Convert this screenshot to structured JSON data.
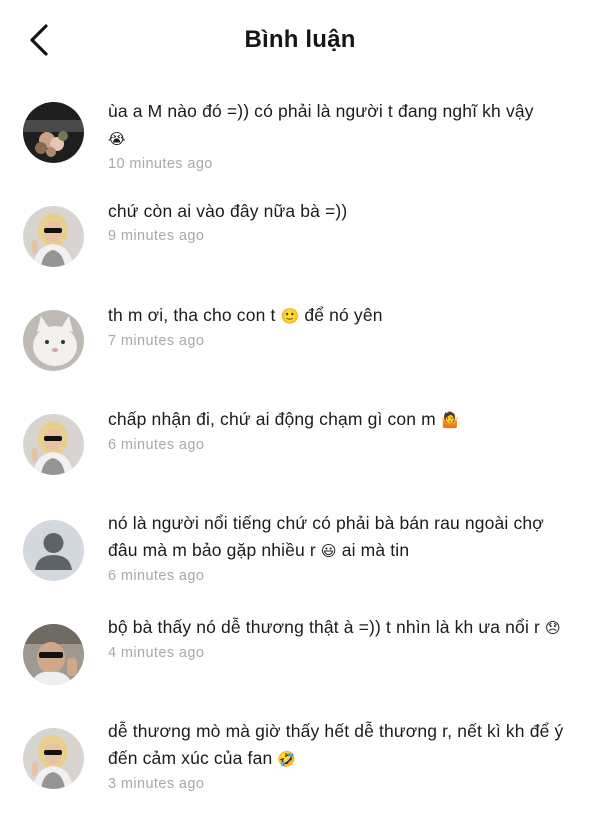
{
  "header": {
    "title": "Bình luận",
    "back_icon": "chevron-left-icon"
  },
  "comments": [
    {
      "text": "ùa a M nào đó =)) có phải là người t đang nghĩ kh vậy",
      "emoji": "😭",
      "emoji_name": "loudly-crying-face",
      "time": "10 minutes ago",
      "avatar": "flowers-photo"
    },
    {
      "text": "chứ còn ai vào đây nữa bà =))",
      "emoji": "",
      "time": "9 minutes ago",
      "avatar": "blonde-girl-sunglasses"
    },
    {
      "text": "th m ơi, tha cho con t",
      "emoji": "🙂",
      "emoji_name": "slightly-smiling-face",
      "text_after": "để nó yên",
      "time": "7 minutes ago",
      "avatar": "white-cat"
    },
    {
      "text": "chấp nhận đi, chứ ai động chạm gì con m",
      "emoji": "🤷",
      "emoji_name": "person-shrugging",
      "time": "6 minutes ago",
      "avatar": "blonde-girl-sunglasses"
    },
    {
      "text": "nó là người nổi tiếng chứ có phải bà bán rau ngoài chợ đâu mà m bảo gặp nhiều r",
      "emoji": "😃",
      "emoji_name": "grinning-face",
      "text_after": "ai mà tin",
      "time": "6 minutes ago",
      "avatar": "default-user"
    },
    {
      "text": "bộ bà thấy nó dễ thương thật à =)) t nhìn là kh ưa nổi r",
      "emoji": "😞",
      "emoji_name": "disappointed-face",
      "time": "4 minutes ago",
      "avatar": "person-sunglasses"
    },
    {
      "text": "dễ thương mò mà giờ thấy hết dễ thương r, nết kì kh để ý đến cảm xúc của fan",
      "emoji": "🤣",
      "emoji_name": "rolling-laughing-face",
      "time": "3 minutes ago",
      "avatar": "blonde-girl-sunglasses"
    }
  ]
}
